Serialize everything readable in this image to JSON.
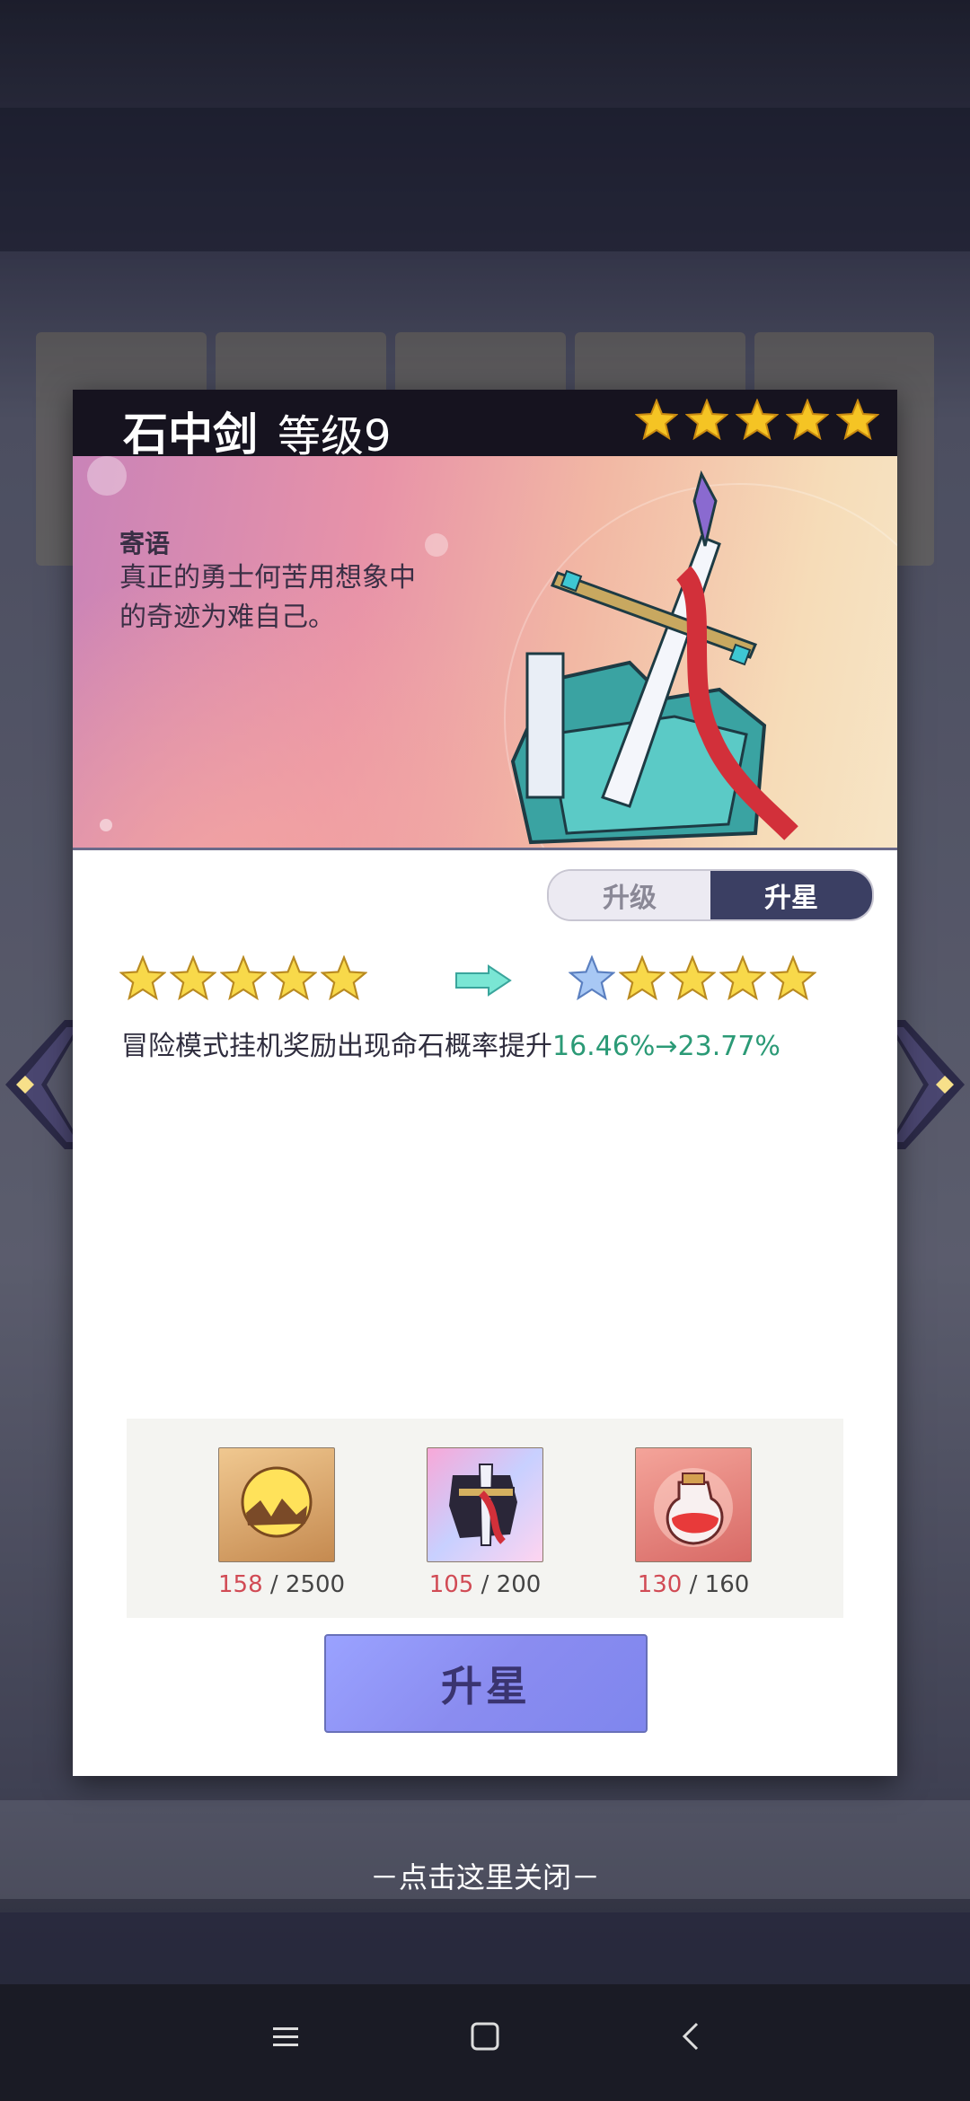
{
  "item": {
    "name": "石中剑",
    "level": "等级9",
    "stars": 5,
    "motto_title": "寄语",
    "motto_text": "真正的勇士何苦用想象中的奇迹为难自己。"
  },
  "tabs": [
    {
      "label": "升级",
      "active": false
    },
    {
      "label": "升星",
      "active": true
    }
  ],
  "star_upgrade": {
    "current_stars": 5,
    "next_stars": 5,
    "description_prefix": "冒险模式挂机奖励出现命石概率提升",
    "description_value": "16.46%→23.77%"
  },
  "costs": [
    {
      "icon": "golden-orb-icon",
      "have": "158",
      "need": "/ 2500"
    },
    {
      "icon": "sword-puzzle-piece-icon",
      "have": "105",
      "need": "/ 200"
    },
    {
      "icon": "red-potion-bottle-icon",
      "have": "130",
      "need": "/ 160"
    }
  ],
  "action_button": "升星",
  "close_hint": "－点击这里关闭－",
  "colors": {
    "header_bg": "#16131f",
    "tab_active": "#3b3f63",
    "highlight_green": "#2b9a76",
    "cost_have_red": "#d14b55",
    "button_bg": "#8a8cf0",
    "star_gold": "#f5c424"
  }
}
